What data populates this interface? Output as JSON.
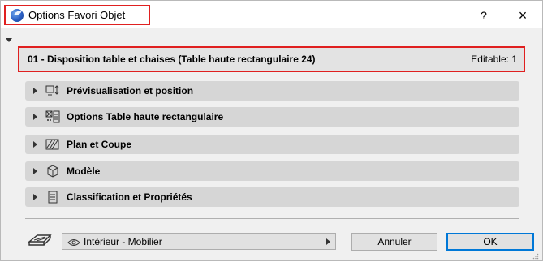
{
  "window": {
    "title": "Options Favori Objet",
    "help_label": "?",
    "close_label": "×"
  },
  "header": {
    "title": "01 - Disposition table et chaises (Table haute rectangulaire 24)",
    "editable": "Editable: 1"
  },
  "sections": [
    {
      "label": "Prévisualisation et position",
      "icon": "preview-position-icon"
    },
    {
      "label": "Options Table haute rectangulaire",
      "icon": "object-options-icon"
    },
    {
      "label": "Plan et Coupe",
      "icon": "plan-section-icon"
    },
    {
      "label": "Modèle",
      "icon": "model-cube-icon"
    },
    {
      "label": "Classification et Propriétés",
      "icon": "classification-icon"
    }
  ],
  "footer": {
    "layer_value": "Intérieur - Mobilier",
    "cancel_label": "Annuler",
    "ok_label": "OK"
  },
  "colors": {
    "highlight_border": "#e02020",
    "section_bg": "#d6d6d6",
    "default_button_border": "#0078d7"
  }
}
